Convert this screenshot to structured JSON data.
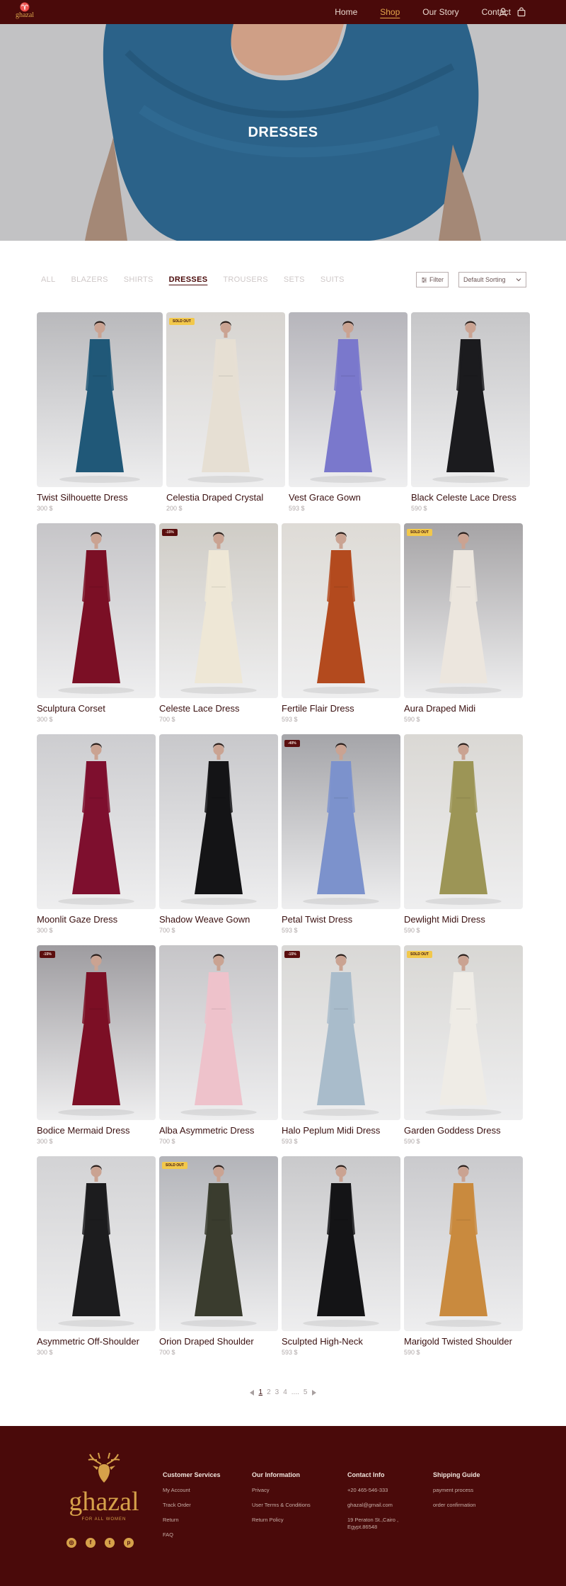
{
  "nav": {
    "logo_text": "ghazal",
    "links": [
      "Home",
      "Shop",
      "Our Story",
      "Contact"
    ],
    "active": "Shop",
    "icons": [
      "user-icon",
      "bag-icon"
    ]
  },
  "hero": {
    "title": "DRESSES"
  },
  "filters": {
    "tabs": [
      "ALL",
      "BLAZERS",
      "SHIRTS",
      "DRESSES",
      "TROUSERS",
      "SETS",
      "SUITS"
    ],
    "active_tab": "DRESSES",
    "filter_label": "Filter",
    "sort_label": "Default Sorting"
  },
  "products": [
    {
      "name": "Twist Silhouette Dress",
      "price": "300 $",
      "badge": "",
      "dress": "#205878",
      "bg": "#b9b9bc"
    },
    {
      "name": "Celestia Draped Crystal",
      "price": "200 $",
      "badge": "SOLD OUT",
      "dress": "#e6dfd3",
      "bg": "#d7d4d0"
    },
    {
      "name": "Vest Grace Gown",
      "price": "593 $",
      "badge": "",
      "dress": "#7a78cc",
      "bg": "#b6b5bb"
    },
    {
      "name": "Black Celeste Lace Dress",
      "price": "590 $",
      "badge": "",
      "dress": "#1b1b1e",
      "bg": "#c6c6c8"
    },
    {
      "name": "Sculptura Corset",
      "price": "300 $",
      "badge": "",
      "dress": "#7b0f25",
      "bg": "#c6c5c8"
    },
    {
      "name": "Celeste Lace Dress",
      "price": "700 $",
      "badge": "-15%",
      "dress": "#eee7d6",
      "bg": "#cfccc6"
    },
    {
      "name": "Fertile Flair Dress",
      "price": "593 $",
      "badge": "",
      "dress": "#b34a1e",
      "bg": "#dedbd6"
    },
    {
      "name": "Aura Draped Midi",
      "price": "590 $",
      "badge": "SOLD OUT",
      "dress": "#ece6de",
      "bg": "#a6a4a6"
    },
    {
      "name": "Moonlit Gaze Dress",
      "price": "300 $",
      "badge": "",
      "dress": "#7e0f2e",
      "bg": "#cdcdd0"
    },
    {
      "name": "Shadow Weave Gown",
      "price": "700 $",
      "badge": "",
      "dress": "#141416",
      "bg": "#c8c8cb"
    },
    {
      "name": "Petal Twist Dress",
      "price": "593 $",
      "badge": "-40%",
      "dress": "#7c92cc",
      "bg": "#a5a5a9"
    },
    {
      "name": "Dewlight Midi Dress",
      "price": "590 $",
      "badge": "",
      "dress": "#9c9556",
      "bg": "#dad8d4"
    },
    {
      "name": "Bodice Mermaid Dress",
      "price": "300 $",
      "badge": "-15%",
      "dress": "#7c0f25",
      "bg": "#9e9ca0"
    },
    {
      "name": "Alba Asymmetric Dress",
      "price": "700 $",
      "badge": "",
      "dress": "#eec2cb",
      "bg": "#c6c5c8"
    },
    {
      "name": "Halo Peplum Midi Dress",
      "price": "593 $",
      "badge": "-15%",
      "dress": "#a9bccb",
      "bg": "#d9d8d6"
    },
    {
      "name": "Garden Goddess Dress",
      "price": "590 $",
      "badge": "SOLD OUT",
      "dress": "#efece6",
      "bg": "#d8d7d4"
    },
    {
      "name": "Asymmetric Off-Shoulder",
      "price": "300 $",
      "badge": "",
      "dress": "#1c1c1e",
      "bg": "#d3d3d5"
    },
    {
      "name": "Orion Draped Shoulder",
      "price": "700 $",
      "badge": "SOLD OUT",
      "dress": "#3a3c2e",
      "bg": "#b3b4b9"
    },
    {
      "name": "Sculpted High-Neck",
      "price": "593 $",
      "badge": "",
      "dress": "#141416",
      "bg": "#c9c9cb"
    },
    {
      "name": "Marigold Twisted Shoulder",
      "price": "590 $",
      "badge": "",
      "dress": "#c98a3e",
      "bg": "#cacacd"
    }
  ],
  "pagination": {
    "pages": [
      "1",
      "2",
      "3",
      "4",
      "....",
      "5"
    ],
    "active": "1"
  },
  "footer": {
    "brand_name": "ghazal",
    "brand_tagline": "FOR ALL WOMEN",
    "social_icons": [
      "instagram-icon",
      "facebook-icon",
      "twitter-icon",
      "pinterest-icon"
    ],
    "columns": [
      {
        "title": "Customer Services",
        "links": [
          "My Account",
          "Track Order",
          "Return",
          "FAQ"
        ]
      },
      {
        "title": "Our Information",
        "links": [
          "Privacy",
          "User Terms & Conditions",
          "Return Policy"
        ]
      },
      {
        "title": "Contact Info",
        "links": [
          "+20  465-546-333",
          "ghazal@gmail.com",
          "19 Peraton St.,Cairo , Egypt.86548"
        ]
      },
      {
        "title": "Shipping Guide",
        "links": [
          "payment process",
          "order confirmation"
        ]
      }
    ]
  }
}
